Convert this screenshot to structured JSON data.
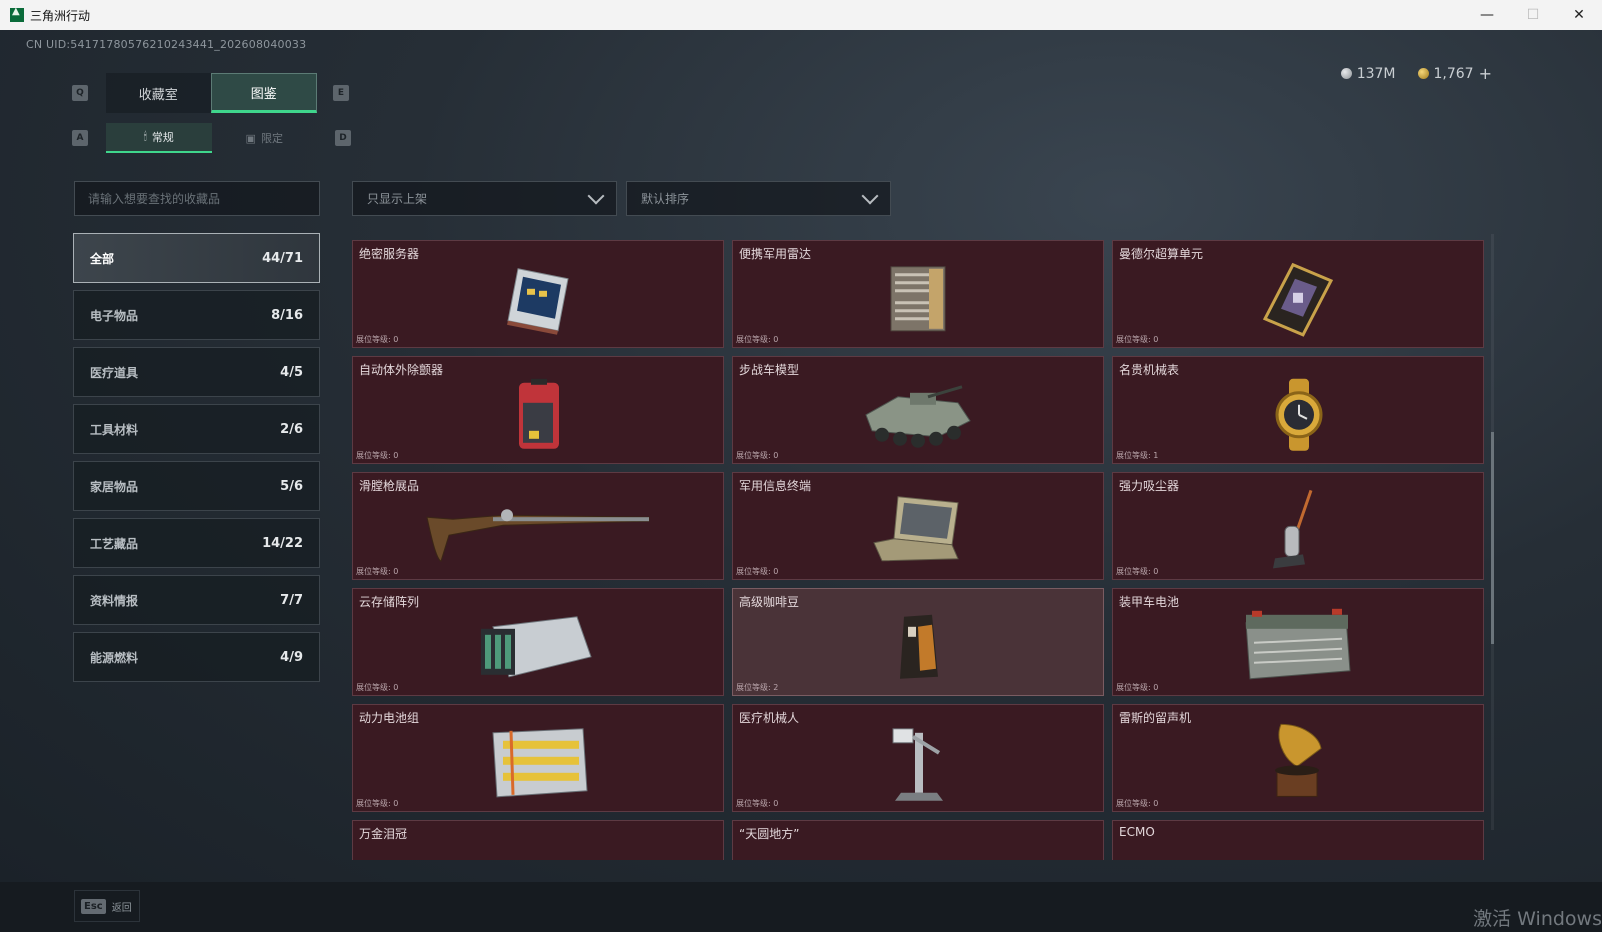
{
  "window": {
    "title": "三角洲行动",
    "minimize": "—",
    "maximize": "☐",
    "close": "✕"
  },
  "header": {
    "uid": "CN UID:54171780576210243441_202608040033"
  },
  "currency": {
    "silver": "137M",
    "gold": "1,767",
    "add": "+"
  },
  "keys": {
    "prev_tab": "Q",
    "next_tab": "E",
    "prev_sub": "A",
    "next_sub": "D"
  },
  "tabs": [
    {
      "label": "收藏室"
    },
    {
      "label": "图鉴"
    }
  ],
  "subtabs": [
    {
      "label": "常规"
    },
    {
      "label": "限定"
    }
  ],
  "search": {
    "placeholder": "请输入想要查找的收藏品"
  },
  "filters": {
    "filter_label": "只显示上架",
    "sort_label": "默认排序"
  },
  "categories": [
    {
      "label": "全部",
      "count": "44/71"
    },
    {
      "label": "电子物品",
      "count": "8/16"
    },
    {
      "label": "医疗道具",
      "count": "4/5"
    },
    {
      "label": "工具材料",
      "count": "2/6"
    },
    {
      "label": "家居物品",
      "count": "5/6"
    },
    {
      "label": "工艺藏品",
      "count": "14/22"
    },
    {
      "label": "资料情报",
      "count": "7/7"
    },
    {
      "label": "能源燃料",
      "count": "4/9"
    }
  ],
  "items": [
    {
      "name": "绝密服务器",
      "level": "展位等级: 0",
      "icon": "server-icon"
    },
    {
      "name": "便携军用雷达",
      "level": "展位等级: 0",
      "icon": "radar-icon"
    },
    {
      "name": "曼德尔超算单元",
      "level": "展位等级: 0",
      "icon": "supercomputer-chip-icon"
    },
    {
      "name": "自动体外除颤器",
      "level": "展位等级: 0",
      "icon": "defibrillator-icon"
    },
    {
      "name": "步战车模型",
      "level": "展位等级: 0",
      "icon": "ifv-model-icon"
    },
    {
      "name": "名贵机械表",
      "level": "展位等级: 1",
      "icon": "watch-icon"
    },
    {
      "name": "滑膛枪展品",
      "level": "展位等级: 0",
      "icon": "musket-icon"
    },
    {
      "name": "军用信息终端",
      "level": "展位等级: 0",
      "icon": "terminal-icon"
    },
    {
      "name": "强力吸尘器",
      "level": "展位等级: 0",
      "icon": "vacuum-icon"
    },
    {
      "name": "云存储阵列",
      "level": "展位等级: 0",
      "icon": "storage-array-icon"
    },
    {
      "name": "高级咖啡豆",
      "level": "展位等级: 2",
      "icon": "coffee-bag-icon"
    },
    {
      "name": "装甲车电池",
      "level": "展位等级: 0",
      "icon": "vehicle-battery-icon"
    },
    {
      "name": "动力电池组",
      "level": "展位等级: 0",
      "icon": "battery-pack-icon"
    },
    {
      "name": "医疗机械人",
      "level": "展位等级: 0",
      "icon": "medical-robot-icon"
    },
    {
      "name": "雷斯的留声机",
      "level": "展位等级: 0",
      "icon": "gramophone-icon"
    },
    {
      "name": "万金泪冠",
      "level": "",
      "icon": "crown-icon"
    },
    {
      "name": "“天圆地方”",
      "level": "",
      "icon": "artifact-icon"
    },
    {
      "name": "ECMO",
      "level": "",
      "icon": "ecmo-icon"
    }
  ],
  "footer": {
    "esc_key": "Esc",
    "esc_label": "返回",
    "watermark": "激活 Windows"
  },
  "colors": {
    "accent": "#3fd68c",
    "card_bg": "#3a1a22",
    "card_highlight": "#4a3338"
  }
}
